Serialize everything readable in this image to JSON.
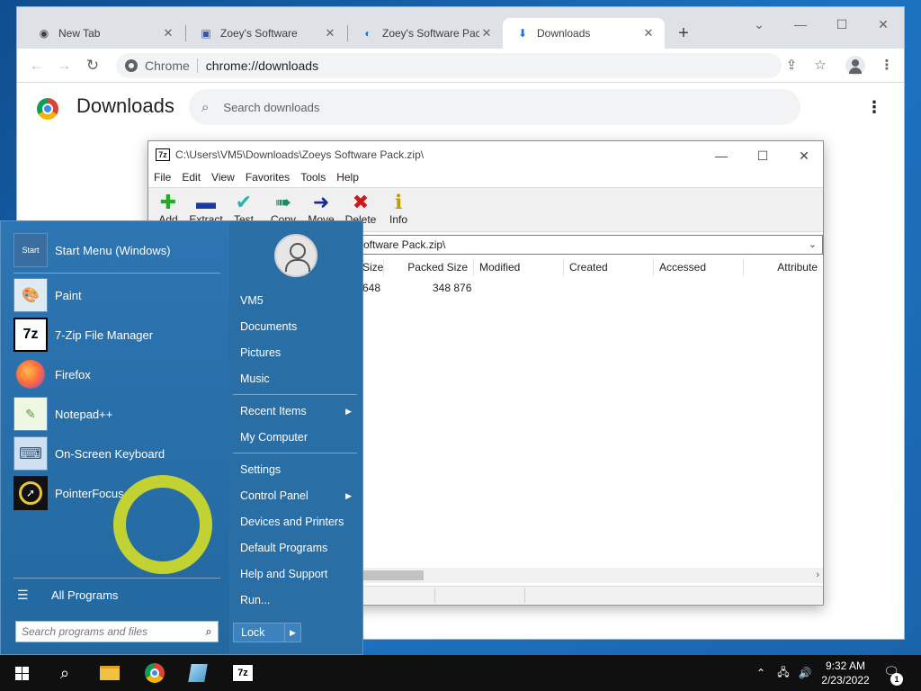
{
  "browser": {
    "tabs": [
      {
        "label": "New Tab",
        "favicon": "chrome-icon"
      },
      {
        "label": "Zoey's Software",
        "favicon": "page-icon"
      },
      {
        "label": "Zoey's Software Pack",
        "favicon": "edge-icon"
      },
      {
        "label": "Downloads",
        "favicon": "download-icon",
        "active": true
      }
    ],
    "omnibox": {
      "chip": "Chrome",
      "url": "chrome://downloads"
    },
    "page": {
      "title": "Downloads",
      "search_placeholder": "Search downloads"
    }
  },
  "sevenzip": {
    "title": "C:\\Users\\VM5\\Downloads\\Zoeys Software Pack.zip\\",
    "menu": [
      "File",
      "Edit",
      "View",
      "Favorites",
      "Tools",
      "Help"
    ],
    "toolbar": [
      {
        "label": "Add",
        "icon": "plus-icon",
        "color": "#22aa22"
      },
      {
        "label": "Extract",
        "icon": "minus-icon",
        "color": "#1a3aa0"
      },
      {
        "label": "Test",
        "icon": "check-icon",
        "color": "#2ab0b0"
      },
      {
        "label": "Copy",
        "icon": "double-arrow-icon",
        "color": "#1a8a6a"
      },
      {
        "label": "Move",
        "icon": "arrow-right-icon",
        "color": "#1a2a90"
      },
      {
        "label": "Delete",
        "icon": "x-icon",
        "color": "#d01818"
      },
      {
        "label": "Info",
        "icon": "info-icon",
        "color": "#b8a000"
      }
    ],
    "path": "oftware Pack.zip\\",
    "columns": [
      "Size",
      "Packed Size",
      "Modified",
      "Created",
      "Accessed",
      "Attribute"
    ],
    "rows": [
      {
        "size": "648",
        "packed_size": "348 876"
      }
    ]
  },
  "start_menu": {
    "pinned": [
      {
        "label": "Start Menu (Windows)",
        "icon": "start-menu-icon"
      },
      {
        "label": "Paint",
        "icon": "paint-icon"
      },
      {
        "label": "7-Zip File Manager",
        "icon": "sevenzip-icon",
        "icon_text": "7z"
      },
      {
        "label": "Firefox",
        "icon": "firefox-icon"
      },
      {
        "label": "Notepad++",
        "icon": "notepadpp-icon"
      },
      {
        "label": "On-Screen Keyboard",
        "icon": "keyboard-icon"
      },
      {
        "label": "PointerFocus",
        "icon": "pointerfocus-icon"
      }
    ],
    "start_icon_text": "Start",
    "all_programs": "All Programs",
    "search_placeholder": "Search programs and files",
    "right": [
      {
        "label": "VM5"
      },
      {
        "label": "Documents"
      },
      {
        "label": "Pictures"
      },
      {
        "label": "Music"
      },
      {
        "label": "Recent Items",
        "submenu": true
      },
      {
        "label": "My Computer"
      },
      {
        "label": "Settings"
      },
      {
        "label": "Control Panel",
        "submenu": true
      },
      {
        "label": "Devices and Printers"
      },
      {
        "label": "Default Programs"
      },
      {
        "label": "Help and Support"
      },
      {
        "label": "Run..."
      }
    ],
    "lock": "Lock"
  },
  "taskbar": {
    "time": "9:32 AM",
    "date": "2/23/2022",
    "notification_count": "1",
    "sevenzip_text": "7z"
  },
  "colors": {
    "ring": "#c2d233",
    "start_menu": "#2a6fa8",
    "taskbar": "#101010"
  }
}
